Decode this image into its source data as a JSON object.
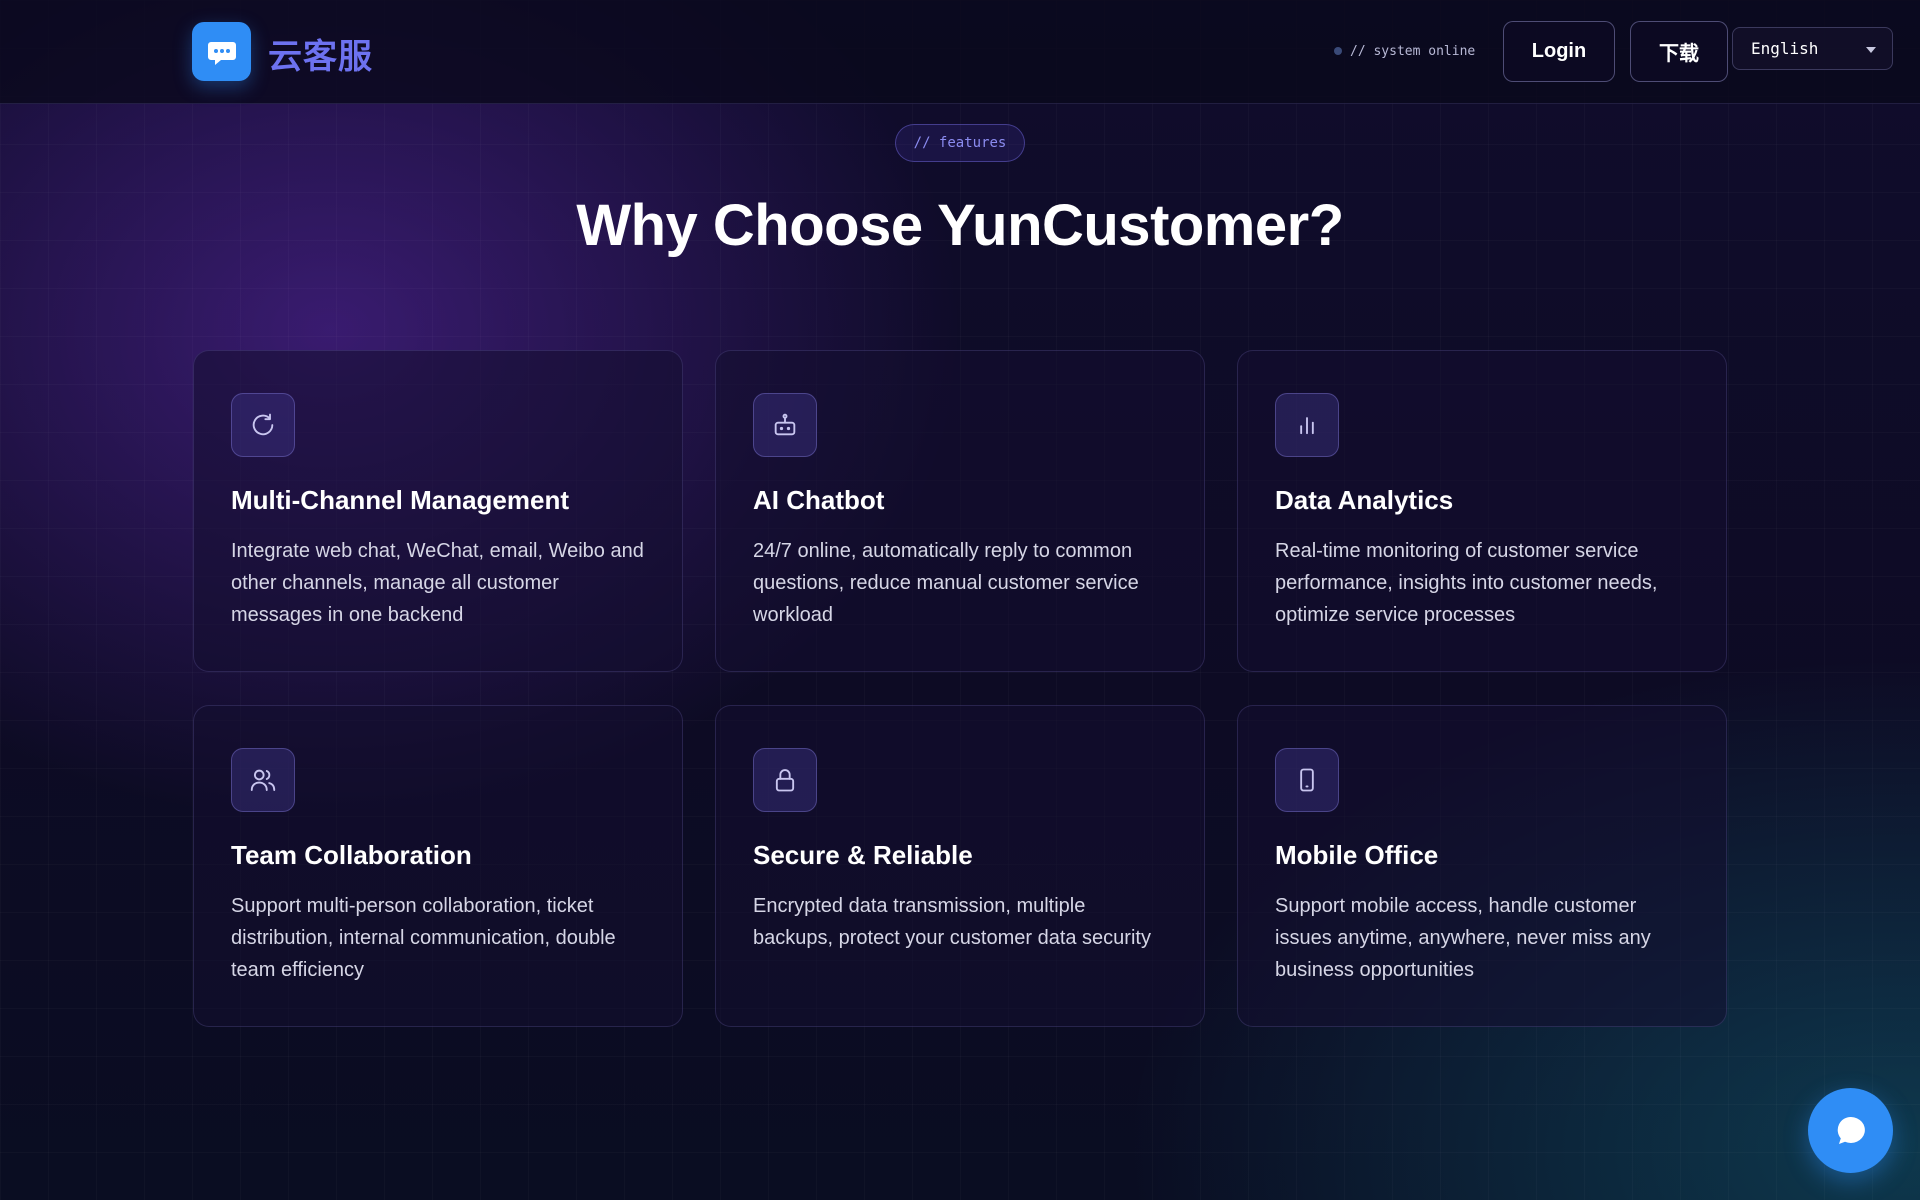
{
  "header": {
    "logo_text": "云客服",
    "logo_icon": "chat-bubble-icon",
    "status_text": "// system online",
    "login_label": "Login",
    "download_label": "下载",
    "language": "English"
  },
  "section": {
    "tag": "// features",
    "heading": "Why Choose YunCustomer?"
  },
  "features": [
    {
      "icon": "refresh-icon",
      "title": "Multi-Channel Management",
      "desc": "Integrate web chat, WeChat, email, Weibo and other channels, manage all customer messages in one backend"
    },
    {
      "icon": "robot-icon",
      "title": "AI Chatbot",
      "desc": "24/7 online, automatically reply to common questions, reduce manual customer service workload"
    },
    {
      "icon": "bar-chart-icon",
      "title": "Data Analytics",
      "desc": "Real-time monitoring of customer service performance, insights into customer needs, optimize service processes"
    },
    {
      "icon": "users-icon",
      "title": "Team Collaboration",
      "desc": "Support multi-person collaboration, ticket distribution, internal communication, double team efficiency"
    },
    {
      "icon": "lock-icon",
      "title": "Secure & Reliable",
      "desc": "Encrypted data transmission, multiple backups, protect your customer data security"
    },
    {
      "icon": "smartphone-icon",
      "title": "Mobile Office",
      "desc": "Support mobile access, handle customer issues anytime, anywhere, never miss any business opportunities"
    }
  ],
  "colors": {
    "accent": "#2f8df5",
    "logo_text": "#6d72f0",
    "tag_text": "#8b8cf0",
    "background": "#0b0920"
  }
}
